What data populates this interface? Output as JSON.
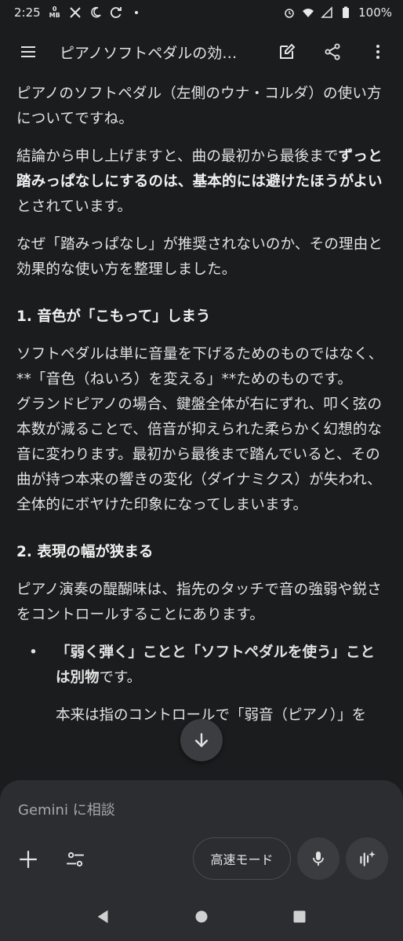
{
  "status_bar": {
    "time": "2:25",
    "data_counter_top": "0",
    "data_counter_bottom": "MB",
    "battery": "100%"
  },
  "app_bar": {
    "title": "ピアノソフトペダルの効…"
  },
  "content": {
    "intro": "ピアノのソフトペダル（左側のウナ・コルダ）の使い方についてですね。",
    "conclusion_pre": "結論から申し上げますと、曲の最初から最後まで",
    "conclusion_bold": "ずっと踏みっぱなしにするのは、基本的には避けたほうがよい",
    "conclusion_post": "とされています。",
    "why": "なぜ「踏みっぱなし」が推奨されないのか、その理由と効果的な使い方を整理しました。",
    "heading1": "1. 音色が「こもって」しまう",
    "p1a": "ソフトペダルは単に音量を下げるためのものではなく、**「音色（ねいろ）を変える」**ためのものです。",
    "p1b": "グランドピアノの場合、鍵盤全体が右にずれ、叩く弦の本数が減ることで、倍音が抑えられた柔らかく幻想的な音に変わります。最初から最後まで踏んでいると、その曲が持つ本来の響きの変化（ダイナミクス）が失われ、全体的にボヤけた印象になってしまいます。",
    "heading2": "2. 表現の幅が狭まる",
    "p2": "ピアノ演奏の醍醐味は、指先のタッチで音の強弱や鋭さをコントロールすることにあります。",
    "bullet1_bold": "「弱く弾く」ことと「ソフトペダルを使う」ことは別物",
    "bullet1_post": "です。",
    "bullet2_partial": "本来は指のコントロールで「弱音（ピアノ）」を"
  },
  "input": {
    "placeholder": "Gemini に相談",
    "mode_label": "高速モード"
  },
  "colors": {
    "background": "#1b1c1d",
    "panel": "#2b2d30",
    "text": "#e3e3e3",
    "muted": "#a6a8ab"
  },
  "icons": {
    "menu": "menu-icon",
    "edit": "edit-icon",
    "share": "share-icon",
    "more": "more-vert-icon",
    "scroll": "arrow-down-icon",
    "plus": "plus-icon",
    "tools": "tune-icon",
    "mic": "mic-icon",
    "live": "gemini-live-icon"
  }
}
